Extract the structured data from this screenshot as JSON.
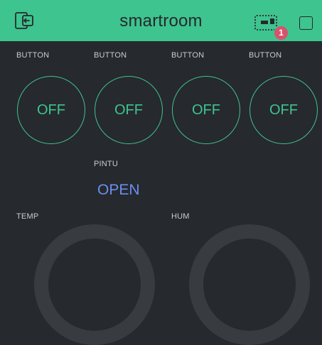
{
  "header": {
    "title": "smartroom",
    "badge_count": "1",
    "background_color": "#3ec48f",
    "icons": [
      "back-icon",
      "device-icon",
      "square-icon"
    ]
  },
  "buttons": [
    {
      "label": "BUTTON",
      "state": "OFF"
    },
    {
      "label": "BUTTON",
      "state": "OFF"
    },
    {
      "label": "BUTTON",
      "state": "OFF"
    },
    {
      "label": "BUTTON",
      "state": "OFF"
    }
  ],
  "pintu": {
    "label": "PINTU",
    "value": "OPEN",
    "value_color": "#6b8ef2"
  },
  "gauges": [
    {
      "label": "TEMP"
    },
    {
      "label": "HUM"
    }
  ],
  "colors": {
    "accent": "#3ec48f",
    "background": "#26292d",
    "badge": "#d8526b"
  }
}
